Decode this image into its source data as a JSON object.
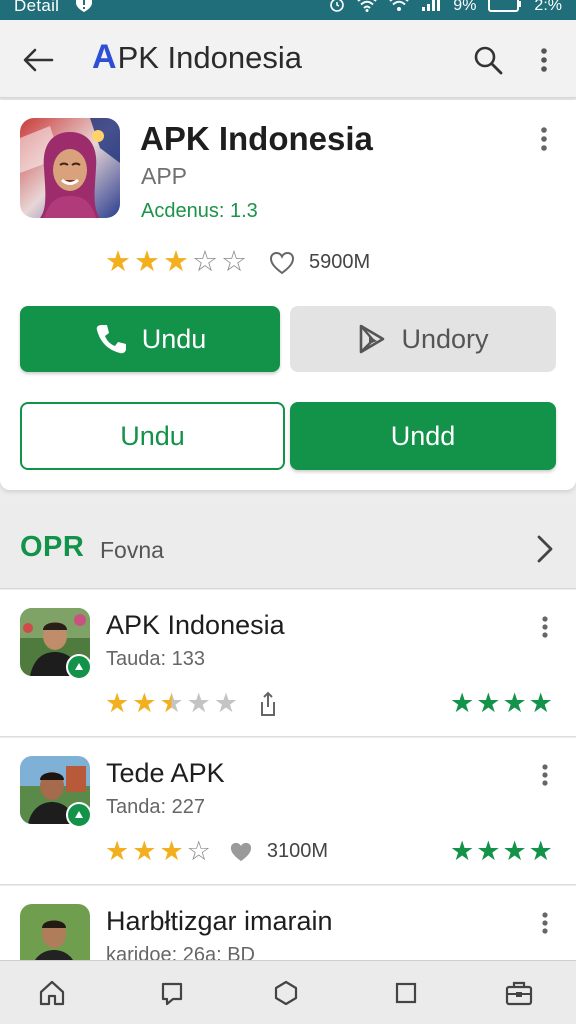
{
  "status_bar": {
    "title": "Detail",
    "battery": "9%",
    "time": "2:%"
  },
  "app_bar": {
    "logo_letter": "A",
    "title_rest": "PK Indonesia"
  },
  "app": {
    "name": "APK Indonesia",
    "type": "APP",
    "version": "Acdenus: 1.3",
    "rating": 3,
    "rating_max": 5,
    "downloads": "5900M"
  },
  "buttons": {
    "primary": "Undu",
    "secondary": "Undory",
    "outline": "Undu",
    "filled": "Undd"
  },
  "section": {
    "heading": "OPR",
    "subheading": "Fovna"
  },
  "list": [
    {
      "title": "APK Indonesia",
      "subtitle": "Tauda: 133",
      "rating": 2.5,
      "green_stars": 4
    },
    {
      "title": "Tede APK",
      "subtitle": "Tanda: 227",
      "rating": 3,
      "downloads": "3100M",
      "green_stars": 4
    },
    {
      "title": "Harbłtizgar imarain",
      "subtitle": "karidoe: 26a: BD"
    }
  ],
  "colors": {
    "accent_green": "#13924a",
    "status_bar": "#1f6e7a",
    "star_gold": "#f2b01e",
    "logo_blue": "#2d4fd6"
  },
  "icons": [
    "back-arrow-icon",
    "search-icon",
    "more-vert-icon",
    "phone-icon",
    "play-store-icon",
    "heart-icon",
    "chevron-right-icon",
    "share-icon",
    "home-icon",
    "square-icon",
    "circle-icon",
    "toolbox-icon"
  ]
}
